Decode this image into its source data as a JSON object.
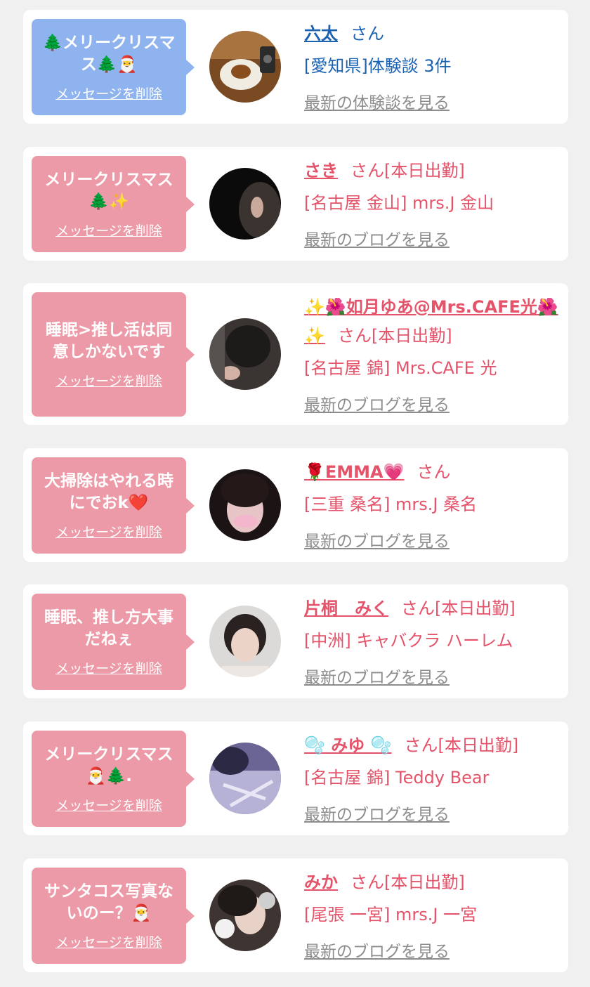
{
  "delete_label": "メッセージを削除",
  "san_label": "さん",
  "colors": {
    "page_bg": "#f0f0f0",
    "blue_bubble": "#8fb3ee",
    "pink_bubble": "#ec9aa7",
    "blue_text": "#1b62b3",
    "pink_text": "#e5536a",
    "link_gray": "#8d8d8d"
  },
  "items": [
    {
      "message": "🌲メリークリスマス🌲🎅",
      "name": "六太",
      "status": "",
      "shop": "[愛知県]体験談 3件",
      "latest": "最新の体験談を見る",
      "avatar_icon": "avatar-photo-cake"
    },
    {
      "message": "メリークリスマス🌲✨",
      "name": "さき",
      "status": "[本日出勤]",
      "shop": "[名古屋 金山] mrs.J 金山",
      "latest": "最新のブログを見る",
      "avatar_icon": "avatar-photo-ear"
    },
    {
      "message": "睡眠>推し活は同意しかないです",
      "name": "✨🌺如月ゆあ@Mrs.CAFE光🌺✨",
      "status": "[本日出勤]",
      "shop": "[名古屋 錦] Mrs.CAFE 光",
      "latest": "最新のブログを見る",
      "avatar_icon": "avatar-photo-hair"
    },
    {
      "message": "大掃除はやれる時にでおk❤️",
      "name": "🌹EMMA💗",
      "status": "",
      "shop": "[三重 桑名] mrs.J 桑名",
      "latest": "最新のブログを見る",
      "avatar_icon": "avatar-photo-emma"
    },
    {
      "message": "睡眠、推し方大事だねぇ",
      "name": "片桐　みく",
      "status": "[本日出勤]",
      "shop": "[中洲] キャバクラ ハーレム",
      "latest": "最新のブログを見る",
      "avatar_icon": "avatar-photo-portrait"
    },
    {
      "message": "メリークリスマス🎅🌲.",
      "name": "🫧 みゆ 🫧",
      "status": "[本日出勤]",
      "shop": "[名古屋 錦] Teddy Bear",
      "latest": "最新のブログを見る",
      "avatar_icon": "avatar-photo-blur"
    },
    {
      "message": "サンタコス写真ないのー？🎅",
      "name": "みか",
      "status": "[本日出勤]",
      "shop": "[尾張 一宮] mrs.J 一宮",
      "latest": "最新のブログを見る",
      "avatar_icon": "avatar-photo-cat"
    }
  ]
}
